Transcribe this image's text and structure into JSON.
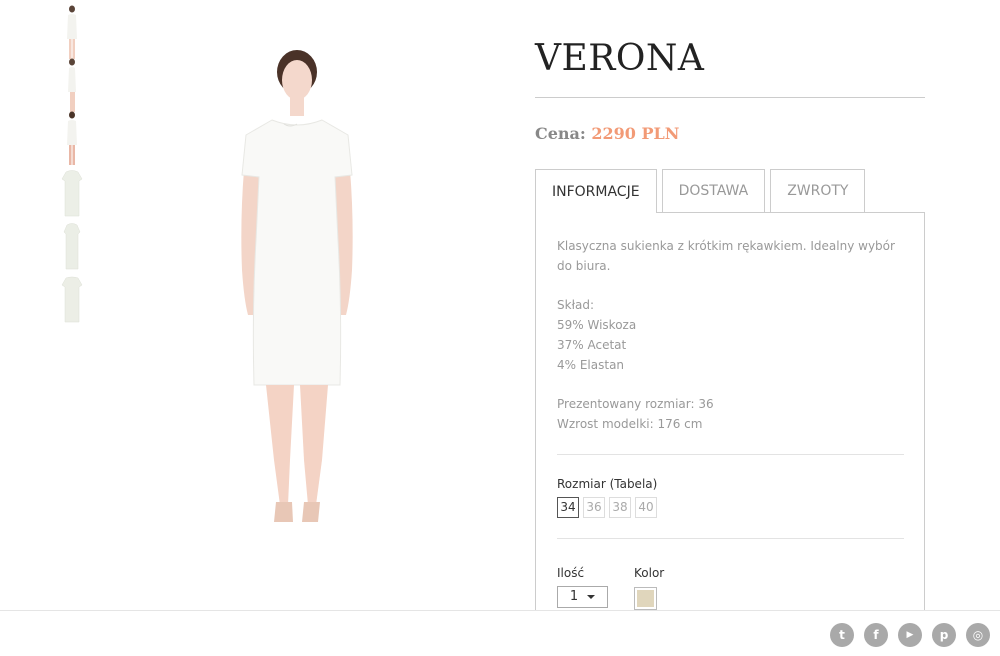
{
  "product": {
    "title": "VERONA",
    "price_label": "Cena:",
    "price_value": "2290 PLN",
    "price_color": "#f29a76"
  },
  "tabs": [
    {
      "label": "INFORMACJE",
      "active": true
    },
    {
      "label": "DOSTAWA",
      "active": false
    },
    {
      "label": "ZWROTY",
      "active": false
    }
  ],
  "info": {
    "description": "Klasyczna sukienka z krótkim rękawkiem. Idealny wybór do biura.",
    "composition_title": "Skład:",
    "composition": [
      "59% Wiskoza",
      "37% Acetat",
      "4% Elastan"
    ],
    "presented_size": "Prezentowany rozmiar: 36",
    "model_height": "Wzrost modelki: 176 cm"
  },
  "size": {
    "label": "Rozmiar (Tabela)",
    "options": [
      "34",
      "36",
      "38",
      "40"
    ],
    "selected": "34"
  },
  "quantity": {
    "label": "Ilość",
    "value": "1"
  },
  "color": {
    "label": "Kolor",
    "swatch": "#e0d6bc"
  },
  "thumbnails": [
    {
      "kind": "model-front"
    },
    {
      "kind": "model-side"
    },
    {
      "kind": "model-back"
    },
    {
      "kind": "dress-front"
    },
    {
      "kind": "dress-side"
    },
    {
      "kind": "dress-back"
    }
  ],
  "social": {
    "icons": [
      "twitter-icon",
      "facebook-icon",
      "youtube-icon",
      "pinterest-icon",
      "instagram-icon"
    ],
    "glyphs": [
      "t",
      "f",
      "▶",
      "p",
      "◎"
    ]
  }
}
